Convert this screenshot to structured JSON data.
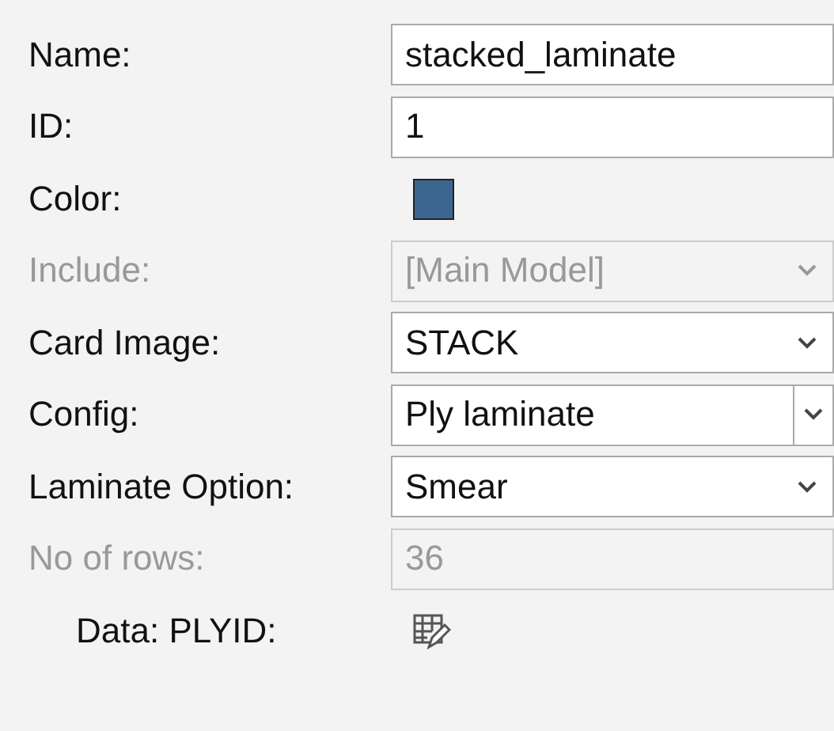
{
  "fields": [
    {
      "label": "Name:",
      "kind": "text",
      "value": "stacked_laminate",
      "disabled": false
    },
    {
      "label": "ID:",
      "kind": "text",
      "value": "1",
      "disabled": false
    },
    {
      "label": "Color:",
      "kind": "color",
      "color": "#3c6690",
      "disabled": false
    },
    {
      "label": "Include:",
      "kind": "dropdown",
      "value": "[Main Model]",
      "disabled": true
    },
    {
      "label": "Card Image:",
      "kind": "dropdown",
      "value": "STACK",
      "disabled": false
    },
    {
      "label": "Config:",
      "kind": "combo",
      "value": "Ply laminate",
      "disabled": false
    },
    {
      "label": "Laminate Option:",
      "kind": "dropdown",
      "value": "Smear",
      "disabled": false
    },
    {
      "label": "No of rows:",
      "kind": "text",
      "value": "36",
      "disabled": true
    },
    {
      "label": "Data: PLYID:",
      "kind": "table",
      "disabled": false
    }
  ]
}
